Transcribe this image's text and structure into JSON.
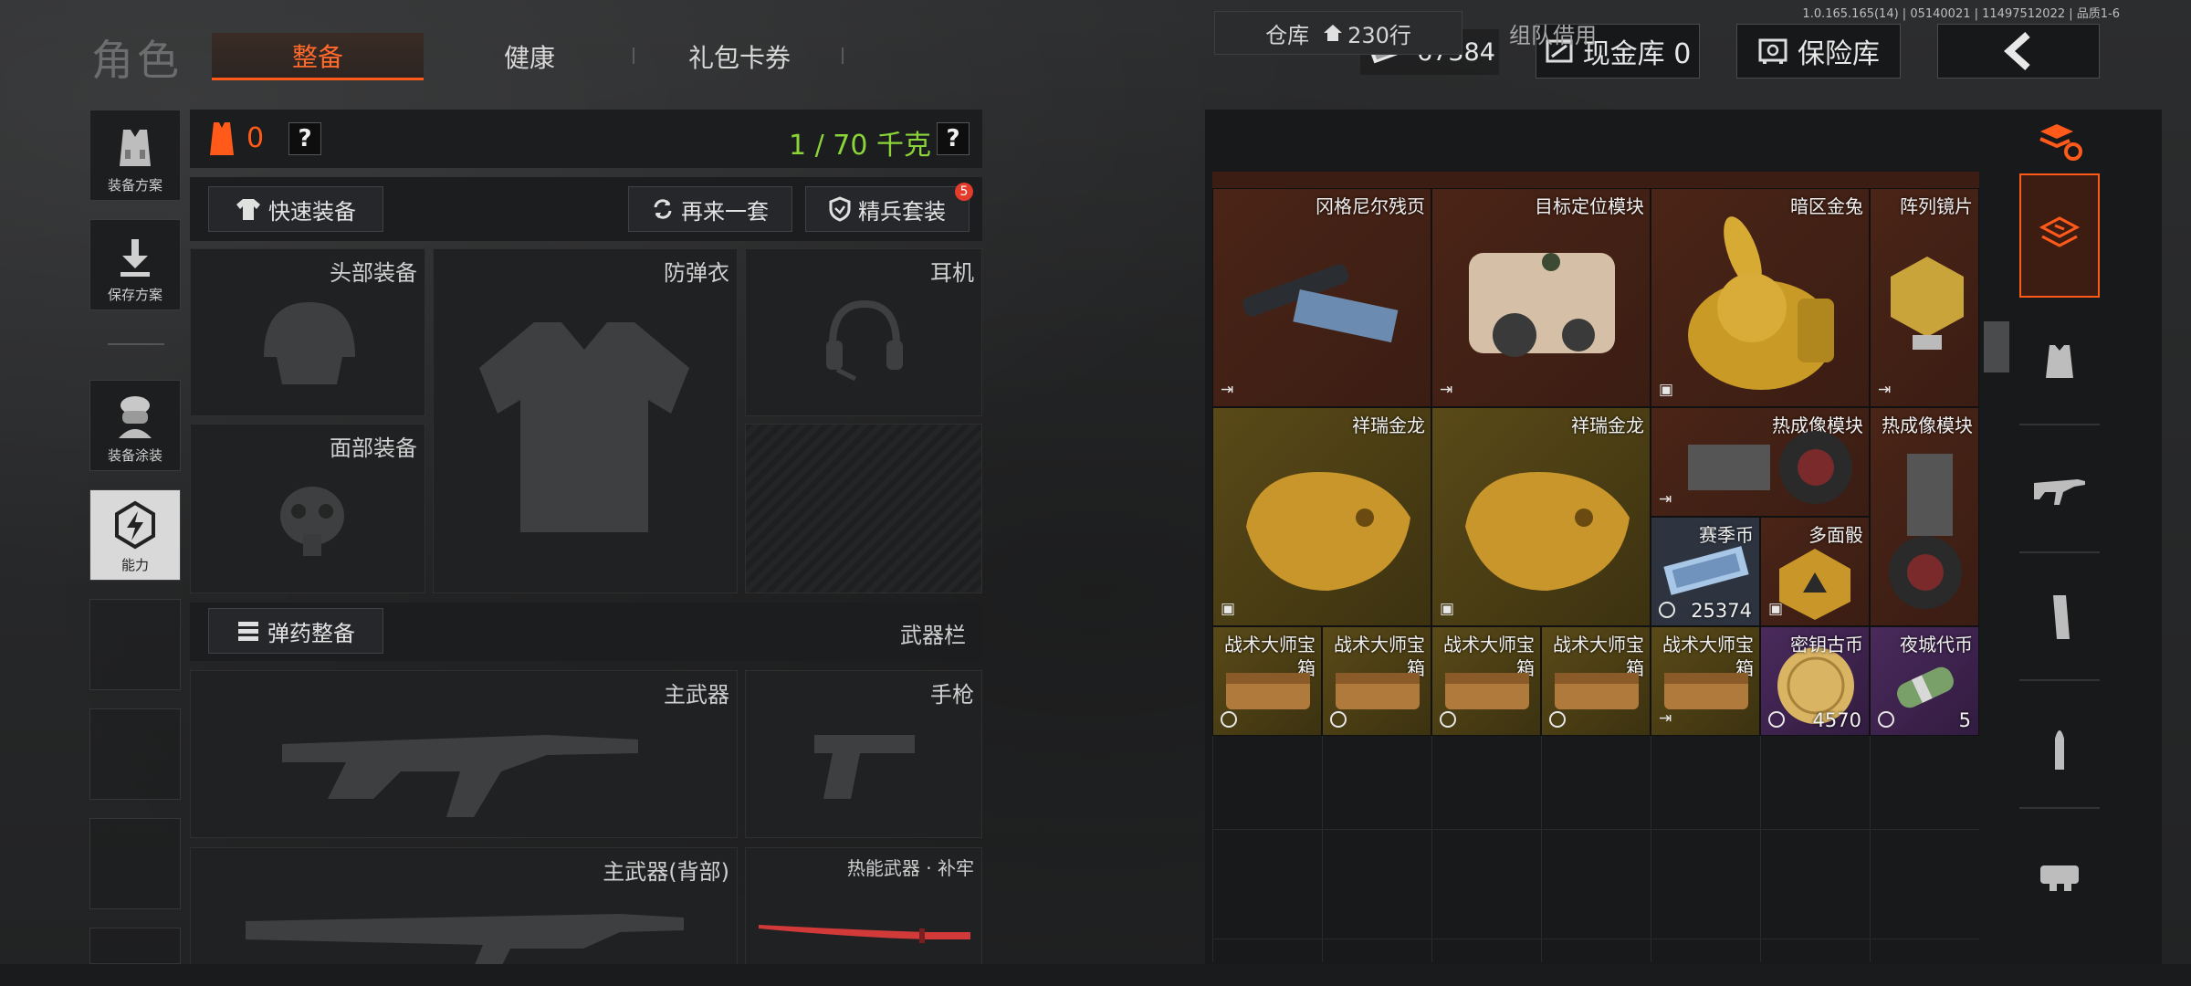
{
  "version": "1.0.165.165(14) | 05140021 | 11497512022 | 品质1-6",
  "header": {
    "title": "角色",
    "tabs": [
      "整备",
      "健康",
      "礼包卡券"
    ],
    "money": "67384",
    "cash_vault": "现金库 0",
    "safe": "保险库"
  },
  "side": {
    "items": [
      "装备方案",
      "保存方案",
      "装备涂装",
      "能力"
    ]
  },
  "equip": {
    "armor_value": "0",
    "weight": "1 / 70 千克",
    "quick_equip": "快速装备",
    "again": "再来一套",
    "elite": "精兵套装",
    "elite_badge": "5",
    "slots": {
      "head": "头部装备",
      "vest": "防弹衣",
      "ear": "耳机",
      "face": "面部装备",
      "ammo": "弹药整备",
      "weapon_bar": "武器栏",
      "primary": "主武器",
      "pistol": "手枪",
      "primary_back": "主武器(背部)",
      "melee": "热能武器 · 补牢"
    }
  },
  "storage": {
    "tab_main": "仓库",
    "rows": "230行",
    "tab_team": "组队借用",
    "items": [
      {
        "name": "冈格尼尔残页",
        "count": ""
      },
      {
        "name": "目标定位模块",
        "count": ""
      },
      {
        "name": "暗区金兔",
        "count": ""
      },
      {
        "name": "阵列镜片",
        "count": ""
      },
      {
        "name": "祥瑞金龙",
        "count": ""
      },
      {
        "name": "祥瑞金龙",
        "count": ""
      },
      {
        "name": "热成像模块",
        "count": ""
      },
      {
        "name": "热成像模块",
        "count": ""
      },
      {
        "name": "赛季币",
        "count": "25374"
      },
      {
        "name": "多面骰",
        "count": ""
      },
      {
        "name": "战术大师宝箱",
        "count": ""
      },
      {
        "name": "战术大师宝箱",
        "count": ""
      },
      {
        "name": "战术大师宝箱",
        "count": ""
      },
      {
        "name": "战术大师宝箱",
        "count": ""
      },
      {
        "name": "战术大师宝箱",
        "count": ""
      },
      {
        "name": "密钥古币",
        "count": "4570"
      },
      {
        "name": "夜城代币",
        "count": "5"
      }
    ]
  },
  "colors": {
    "accent": "#ff5a1a",
    "weight_green": "#8bd43a"
  }
}
